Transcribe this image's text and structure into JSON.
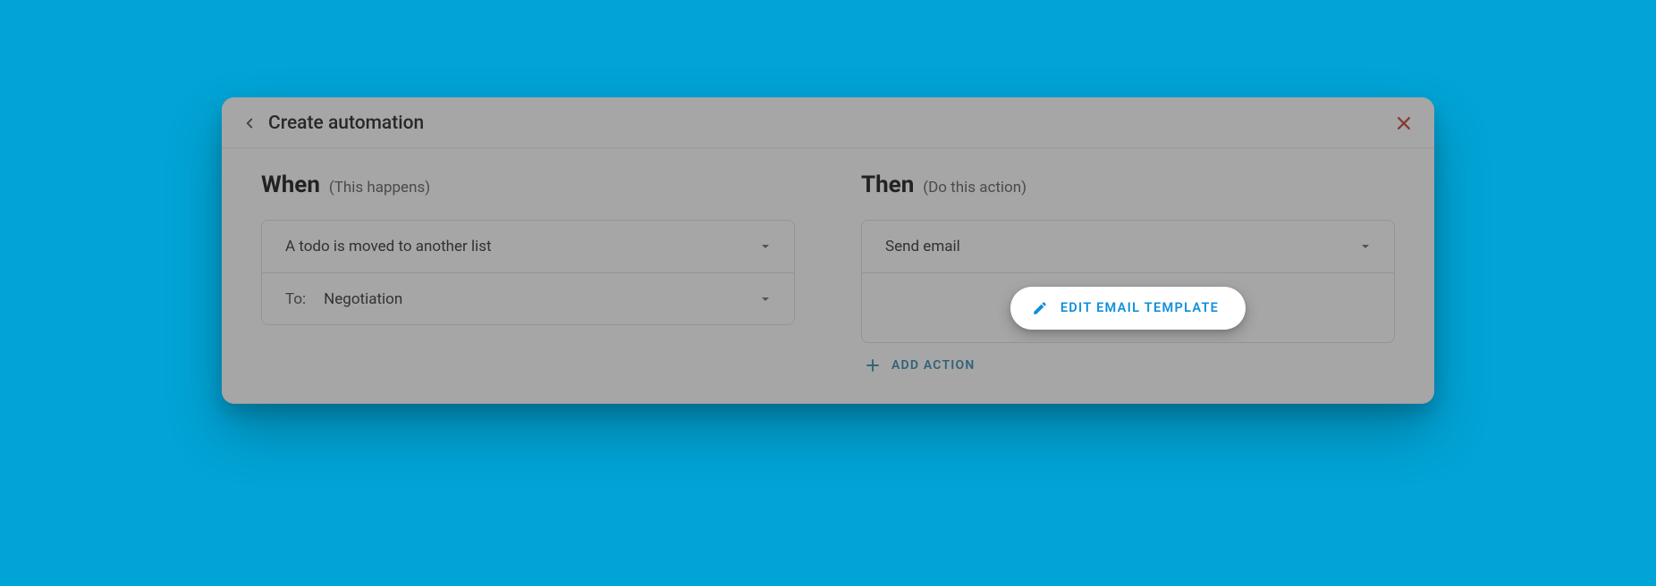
{
  "header": {
    "title": "Create automation"
  },
  "when": {
    "heading": "When",
    "sub": "(This happens)",
    "trigger_value": "A todo is moved to another list",
    "to_label": "To:",
    "to_value": "Negotiation"
  },
  "then": {
    "heading": "Then",
    "sub": "(Do this action)",
    "action_value": "Send email",
    "edit_template_label": "EDIT EMAIL TEMPLATE",
    "add_action_label": "ADD ACTION"
  }
}
